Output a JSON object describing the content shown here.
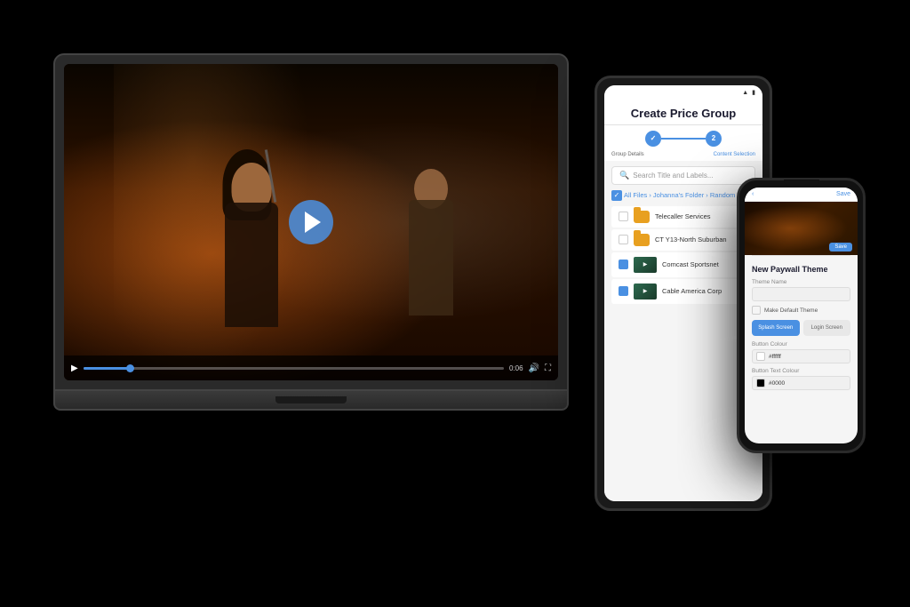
{
  "scene": {
    "background": "#000000"
  },
  "laptop": {
    "video": {
      "time_elapsed": "0:06",
      "progress_percent": 12
    }
  },
  "tablet": {
    "title": "Create Price Group",
    "status_bar": {
      "icons": [
        "wifi",
        "battery"
      ]
    },
    "stepper": {
      "step1_label": "Group Details",
      "step2_label": "Content Selection",
      "current_step": 2
    },
    "search": {
      "placeholder": "Search Title and Labels..."
    },
    "breadcrumb": "All Files › Johanna's Folder › Random",
    "files": [
      {
        "name": "Telecaller Services",
        "type": "folder",
        "checked": false
      },
      {
        "name": "CT Y13-North Suburban",
        "type": "folder",
        "checked": false
      },
      {
        "name": "Comcast Sportsnet",
        "type": "video",
        "checked": true
      },
      {
        "name": "Cable America Corp",
        "type": "video",
        "checked": true
      }
    ]
  },
  "phone": {
    "header": {
      "back_label": "‹",
      "title": "",
      "action_label": "Save"
    },
    "section_title": "New Paywall Theme",
    "fields": [
      {
        "label": "Theme Name",
        "value": "",
        "placeholder": ""
      }
    ],
    "default_checkbox_label": "Make Default Theme",
    "tabs": [
      {
        "label": "Splash Screen",
        "active": true
      },
      {
        "label": "Login Screen",
        "active": false
      }
    ],
    "button_color_label": "Button Colour",
    "button_color_value": "#ffffff",
    "button_text_color_label": "Button Text Colour",
    "button_text_color_value": "#0000"
  }
}
